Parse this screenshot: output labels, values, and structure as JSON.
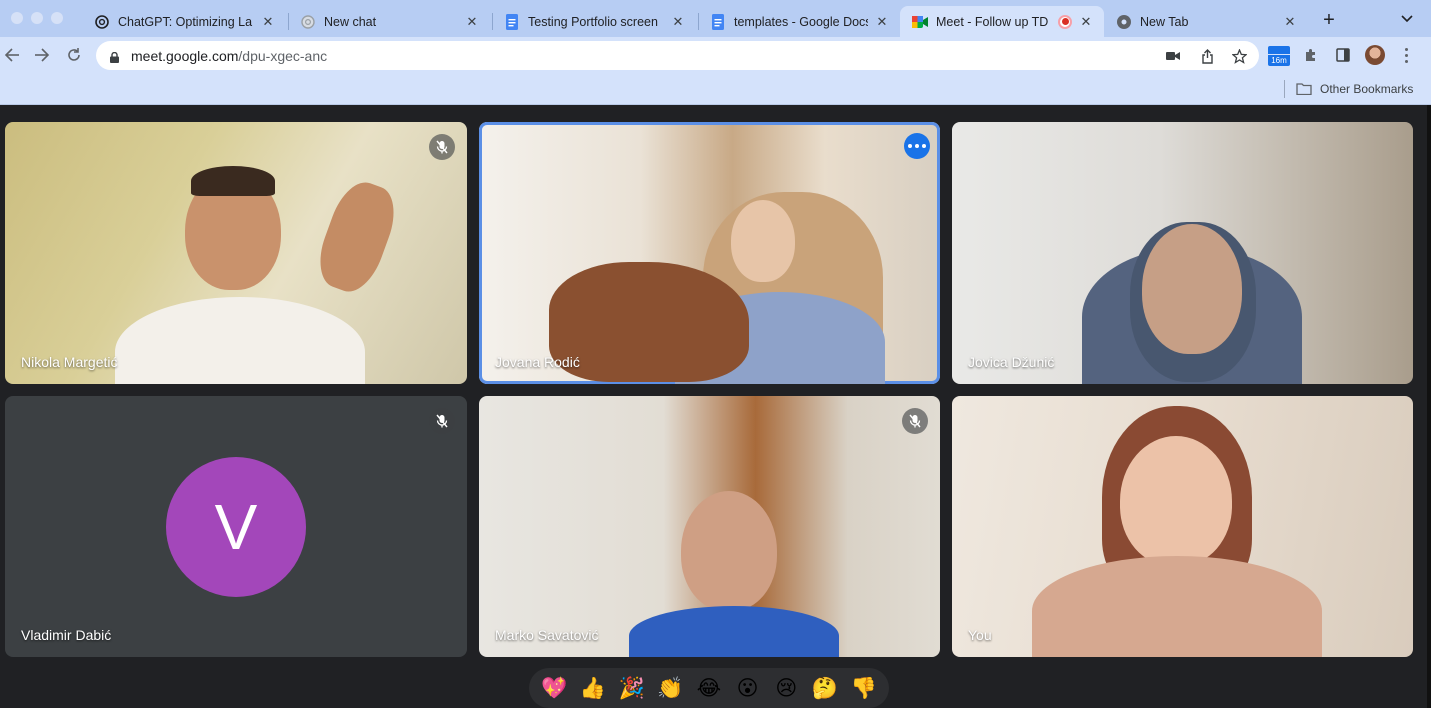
{
  "tabs": [
    {
      "title": "ChatGPT: Optimizing La",
      "icon": "openai-icon",
      "active": false
    },
    {
      "title": "New chat",
      "icon": "openai-icon",
      "active": false
    },
    {
      "title": "Testing Portfolio screen",
      "icon": "google-docs-icon",
      "active": false
    },
    {
      "title": "templates - Google Docs",
      "icon": "google-docs-icon",
      "active": false
    },
    {
      "title": "Meet - Follow up TD",
      "icon": "google-meet-icon",
      "active": true,
      "recording": true
    },
    {
      "title": "New Tab",
      "icon": "chrome-icon",
      "active": false
    }
  ],
  "toolbar": {
    "url_host": "meet.google.com",
    "url_path": "/dpu-xgec-anc",
    "calendar_badge": "16m"
  },
  "bookmarks": {
    "other_label": "Other Bookmarks"
  },
  "participants": [
    {
      "name": "Nikola Margetić",
      "muted": true,
      "speaking": false
    },
    {
      "name": "Jovana Rodić",
      "muted": false,
      "speaking": true
    },
    {
      "name": "Jovica Džunić",
      "muted": false,
      "speaking": false
    },
    {
      "name": "Vladimir Dabić",
      "muted": true,
      "speaking": false,
      "avatar_letter": "V",
      "avatar_color": "#a347ba"
    },
    {
      "name": "Marko Savatović",
      "muted": true,
      "speaking": false
    },
    {
      "name": "You",
      "muted": false,
      "speaking": false
    }
  ],
  "reactions": [
    "💖",
    "👍",
    "🎉",
    "👏",
    "😂",
    "😮",
    "😢",
    "🤔",
    "👎"
  ],
  "colors": {
    "accent": "#1a73e8",
    "meet_bg": "#202124",
    "tab_strip": "#b7cdf3"
  }
}
